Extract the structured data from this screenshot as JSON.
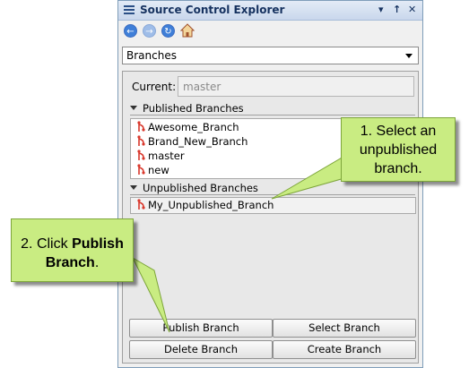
{
  "window": {
    "title": "Source Control Explorer",
    "pin_glyph": "↑",
    "close_glyph": "✕"
  },
  "toolbar": {
    "buttons": [
      {
        "icon": "back-arrow-icon",
        "glyph": "←"
      },
      {
        "icon": "forward-arrow-icon",
        "glyph": "→"
      },
      {
        "icon": "refresh-icon",
        "glyph": "↻"
      },
      {
        "icon": "home-icon",
        "glyph": ""
      }
    ]
  },
  "view_selector": {
    "value": "Branches"
  },
  "current": {
    "label": "Current:",
    "value": "master"
  },
  "published": {
    "header": "Published Branches",
    "items": [
      "Awesome_Branch",
      "Brand_New_Branch",
      "master",
      "new"
    ]
  },
  "unpublished": {
    "header": "Unpublished Branches",
    "items": [
      "My_Unpublished_Branch"
    ]
  },
  "buttons": {
    "publish": "Publish Branch",
    "select": "Select Branch",
    "delete": "Delete Branch",
    "create": "Create Branch"
  },
  "callouts": {
    "step1": {
      "line1": "1. Select an",
      "line2": "unpublished",
      "line3": "branch."
    },
    "step2": {
      "prefix": "2. Click ",
      "bold1": "Publish",
      "bold2": "Branch",
      "suffix": "."
    }
  },
  "colors": {
    "callout_fill": "#c9ec82",
    "branch_icon": "#d9382c",
    "accent": "#2b4f86"
  }
}
